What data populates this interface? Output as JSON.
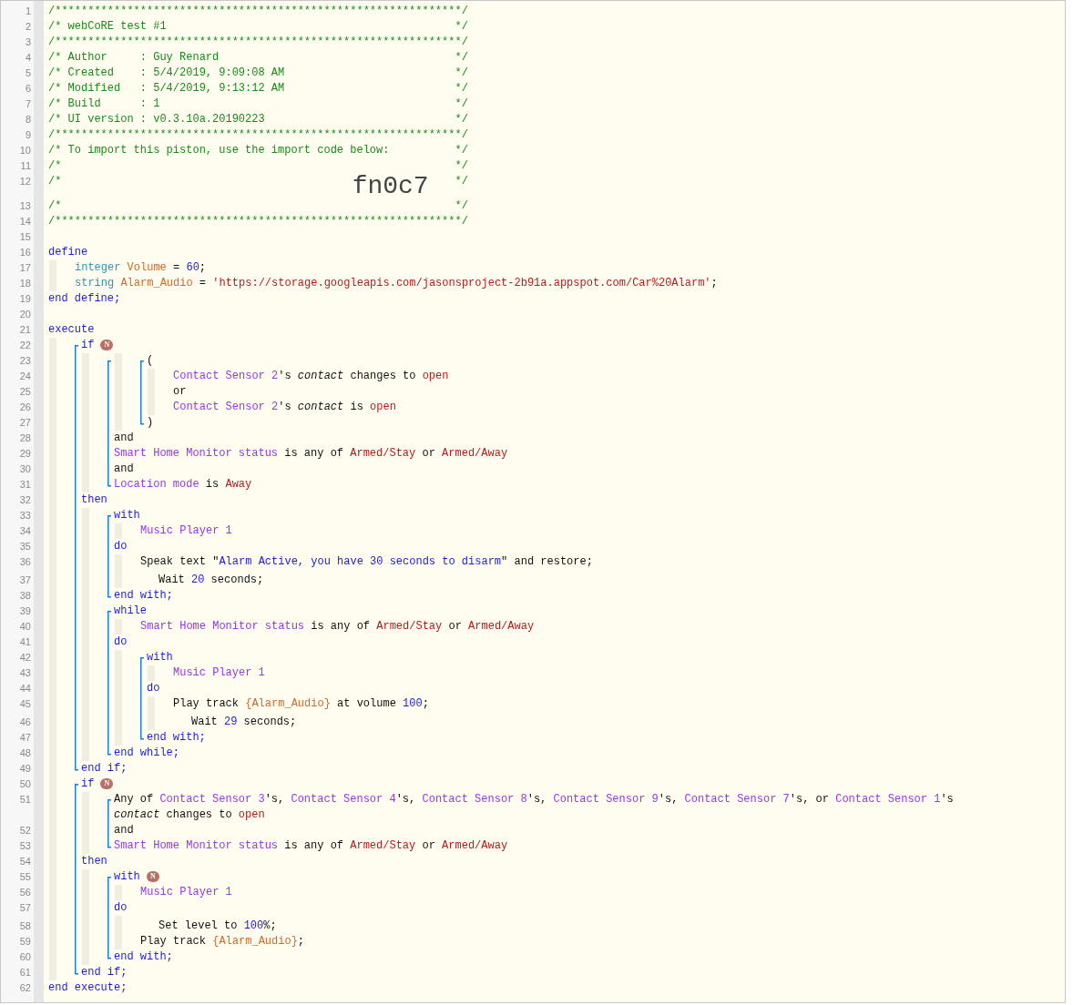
{
  "lines": [
    {
      "kind": "line",
      "no": "1",
      "tokens": [
        {
          "kind": "comment",
          "text": "/**************************************************************/"
        }
      ]
    },
    {
      "kind": "line",
      "no": "2",
      "tokens": [
        {
          "kind": "comment",
          "text": "/* webCoRE test #1"
        },
        {
          "kind": "comment-end",
          "text": "*/"
        }
      ]
    },
    {
      "kind": "line",
      "no": "3",
      "tokens": [
        {
          "kind": "comment",
          "text": "/**************************************************************/"
        }
      ]
    },
    {
      "kind": "line",
      "no": "4",
      "tokens": [
        {
          "kind": "comment",
          "text": "/* Author     : Guy Renard"
        },
        {
          "kind": "comment-end",
          "text": "*/"
        }
      ]
    },
    {
      "kind": "line",
      "no": "5",
      "tokens": [
        {
          "kind": "comment",
          "text": "/* Created    : 5/4/2019, 9:09:08 AM"
        },
        {
          "kind": "comment-end",
          "text": "*/"
        }
      ]
    },
    {
      "kind": "line",
      "no": "6",
      "tokens": [
        {
          "kind": "comment",
          "text": "/* Modified   : 5/4/2019, 9:13:12 AM"
        },
        {
          "kind": "comment-end",
          "text": "*/"
        }
      ]
    },
    {
      "kind": "line",
      "no": "7",
      "tokens": [
        {
          "kind": "comment",
          "text": "/* Build      : 1"
        },
        {
          "kind": "comment-end",
          "text": "*/"
        }
      ]
    },
    {
      "kind": "line",
      "no": "8",
      "tokens": [
        {
          "kind": "comment",
          "text": "/* UI version : v0.3.10a.20190223"
        },
        {
          "kind": "comment-end",
          "text": "*/"
        }
      ]
    },
    {
      "kind": "line",
      "no": "9",
      "tokens": [
        {
          "kind": "comment",
          "text": "/**************************************************************/"
        }
      ]
    },
    {
      "kind": "line",
      "no": "10",
      "tokens": [
        {
          "kind": "comment",
          "text": "/* To import this piston, use the import code below:"
        },
        {
          "kind": "comment-end",
          "text": "*/"
        }
      ]
    },
    {
      "kind": "line",
      "no": "11",
      "tokens": [
        {
          "kind": "comment",
          "text": "/*"
        },
        {
          "kind": "comment-end",
          "text": "*/"
        }
      ]
    },
    {
      "kind": "line",
      "no": "12",
      "tokens": [
        {
          "kind": "comment",
          "text": "/*"
        },
        {
          "kind": "import-code",
          "text": "fn0c7"
        },
        {
          "kind": "comment-end",
          "text": "*/"
        }
      ]
    },
    {
      "kind": "line",
      "no": "13",
      "tokens": [
        {
          "kind": "comment",
          "text": "/*"
        },
        {
          "kind": "comment-end",
          "text": "*/"
        }
      ]
    },
    {
      "kind": "line",
      "no": "14",
      "tokens": [
        {
          "kind": "comment",
          "text": "/**************************************************************/"
        }
      ]
    },
    {
      "kind": "line",
      "no": "15"
    },
    {
      "kind": "line",
      "no": "16",
      "tokens": [
        {
          "kind": "keyword",
          "text": "define"
        }
      ]
    },
    {
      "kind": "indent",
      "children": [
        {
          "kind": "line",
          "no": "17",
          "tokens": [
            {
              "kind": "type",
              "text": "integer "
            },
            {
              "kind": "variable",
              "text": "Volume"
            },
            {
              "kind": "plain",
              "text": " = "
            },
            {
              "kind": "literal",
              "text": "60"
            },
            {
              "kind": "plain",
              "text": ";"
            }
          ]
        },
        {
          "kind": "line",
          "no": "18",
          "tokens": [
            {
              "kind": "type",
              "text": "string "
            },
            {
              "kind": "variable",
              "text": "Alarm_Audio"
            },
            {
              "kind": "plain",
              "text": " = "
            },
            {
              "kind": "value",
              "text": "'https://storage.googleapis.com/jasonsproject-2b91a.appspot.com/Car%20Alarm'"
            },
            {
              "kind": "plain",
              "text": ";"
            }
          ]
        }
      ]
    },
    {
      "kind": "line",
      "no": "19",
      "tokens": [
        {
          "kind": "keyword",
          "text": "end define;"
        }
      ]
    },
    {
      "kind": "line",
      "no": "20"
    },
    {
      "kind": "line",
      "no": "21",
      "tokens": [
        {
          "kind": "keyword",
          "text": "execute"
        }
      ]
    },
    {
      "kind": "indent",
      "children": [
        {
          "kind": "bracket",
          "children": [
            {
              "kind": "line",
              "no": "22",
              "tokens": [
                {
                  "kind": "keyword",
                  "text": "if"
                }
              ],
              "badge": "N"
            },
            {
              "kind": "indent",
              "children": [
                {
                  "kind": "bracket",
                  "children": [
                    {
                      "kind": "indent",
                      "children": [
                        {
                          "kind": "bracket",
                          "children": [
                            {
                              "kind": "line",
                              "no": "23",
                              "tokens": [
                                {
                                  "kind": "plain",
                                  "text": "("
                                }
                              ]
                            },
                            {
                              "kind": "indent",
                              "children": [
                                {
                                  "kind": "line",
                                  "no": "24",
                                  "tokens": [
                                    {
                                      "kind": "device",
                                      "text": "Contact Sensor 2"
                                    },
                                    {
                                      "kind": "plain",
                                      "text": "'s "
                                    },
                                    {
                                      "kind": "attribute",
                                      "text": "contact"
                                    },
                                    {
                                      "kind": "plain",
                                      "text": " changes to "
                                    },
                                    {
                                      "kind": "value",
                                      "text": "open"
                                    }
                                  ]
                                },
                                {
                                  "kind": "line",
                                  "no": "25",
                                  "tokens": [
                                    {
                                      "kind": "plain",
                                      "text": "or"
                                    }
                                  ]
                                },
                                {
                                  "kind": "line",
                                  "no": "26",
                                  "tokens": [
                                    {
                                      "kind": "device",
                                      "text": "Contact Sensor 2"
                                    },
                                    {
                                      "kind": "plain",
                                      "text": "'s "
                                    },
                                    {
                                      "kind": "attribute",
                                      "text": "contact"
                                    },
                                    {
                                      "kind": "plain",
                                      "text": " is "
                                    },
                                    {
                                      "kind": "value",
                                      "text": "open"
                                    }
                                  ]
                                }
                              ]
                            },
                            {
                              "kind": "line",
                              "no": "27",
                              "tokens": [
                                {
                                  "kind": "plain",
                                  "text": ")"
                                }
                              ]
                            }
                          ]
                        }
                      ]
                    },
                    {
                      "kind": "line",
                      "no": "28",
                      "tokens": [
                        {
                          "kind": "plain",
                          "text": "and"
                        }
                      ]
                    },
                    {
                      "kind": "line",
                      "no": "29",
                      "tokens": [
                        {
                          "kind": "device",
                          "text": "Smart Home Monitor status"
                        },
                        {
                          "kind": "plain",
                          "text": " is any of "
                        },
                        {
                          "kind": "value",
                          "text": "Armed/Stay"
                        },
                        {
                          "kind": "plain",
                          "text": " or "
                        },
                        {
                          "kind": "value",
                          "text": "Armed/Away"
                        }
                      ]
                    },
                    {
                      "kind": "line",
                      "no": "30",
                      "tokens": [
                        {
                          "kind": "plain",
                          "text": "and"
                        }
                      ]
                    },
                    {
                      "kind": "line",
                      "no": "31",
                      "tokens": [
                        {
                          "kind": "device",
                          "text": "Location mode"
                        },
                        {
                          "kind": "plain",
                          "text": " is "
                        },
                        {
                          "kind": "value",
                          "text": "Away"
                        }
                      ]
                    }
                  ]
                }
              ]
            },
            {
              "kind": "line",
              "no": "32",
              "tokens": [
                {
                  "kind": "keyword",
                  "text": "then"
                }
              ]
            },
            {
              "kind": "indent",
              "children": [
                {
                  "kind": "bracket",
                  "children": [
                    {
                      "kind": "line",
                      "no": "33",
                      "tokens": [
                        {
                          "kind": "keyword",
                          "text": "with"
                        }
                      ]
                    },
                    {
                      "kind": "indent",
                      "children": [
                        {
                          "kind": "line",
                          "no": "34",
                          "tokens": [
                            {
                              "kind": "device",
                              "text": "Music Player 1"
                            }
                          ]
                        }
                      ]
                    },
                    {
                      "kind": "line",
                      "no": "35",
                      "tokens": [
                        {
                          "kind": "keyword",
                          "text": "do"
                        }
                      ]
                    },
                    {
                      "kind": "indent",
                      "children": [
                        {
                          "kind": "line",
                          "no": "36",
                          "tokens": [
                            {
                              "kind": "plain",
                              "text": "Speak text \""
                            },
                            {
                              "kind": "literal",
                              "text": "Alarm Active, you have 30 seconds to disarm"
                            },
                            {
                              "kind": "plain",
                              "text": "\" and restore;"
                            }
                          ]
                        },
                        {
                          "kind": "shift",
                          "children": [
                            {
                              "kind": "line",
                              "no": "37",
                              "tokens": [
                                {
                                  "kind": "plain",
                                  "text": "Wait "
                                },
                                {
                                  "kind": "literal",
                                  "text": "20"
                                },
                                {
                                  "kind": "plain",
                                  "text": " seconds;"
                                }
                              ]
                            }
                          ]
                        }
                      ]
                    },
                    {
                      "kind": "line",
                      "no": "38",
                      "tokens": [
                        {
                          "kind": "keyword",
                          "text": "end with;"
                        }
                      ]
                    }
                  ]
                },
                {
                  "kind": "bracket",
                  "children": [
                    {
                      "kind": "line",
                      "no": "39",
                      "tokens": [
                        {
                          "kind": "keyword",
                          "text": "while"
                        }
                      ]
                    },
                    {
                      "kind": "indent",
                      "children": [
                        {
                          "kind": "line",
                          "no": "40",
                          "tokens": [
                            {
                              "kind": "device",
                              "text": "Smart Home Monitor status"
                            },
                            {
                              "kind": "plain",
                              "text": " is any of "
                            },
                            {
                              "kind": "value",
                              "text": "Armed/Stay"
                            },
                            {
                              "kind": "plain",
                              "text": " or "
                            },
                            {
                              "kind": "value",
                              "text": "Armed/Away"
                            }
                          ]
                        }
                      ]
                    },
                    {
                      "kind": "line",
                      "no": "41",
                      "tokens": [
                        {
                          "kind": "keyword",
                          "text": "do"
                        }
                      ]
                    },
                    {
                      "kind": "indent",
                      "children": [
                        {
                          "kind": "bracket",
                          "children": [
                            {
                              "kind": "line",
                              "no": "42",
                              "tokens": [
                                {
                                  "kind": "keyword",
                                  "text": "with"
                                }
                              ]
                            },
                            {
                              "kind": "indent",
                              "children": [
                                {
                                  "kind": "line",
                                  "no": "43",
                                  "tokens": [
                                    {
                                      "kind": "device",
                                      "text": "Music Player 1"
                                    }
                                  ]
                                }
                              ]
                            },
                            {
                              "kind": "line",
                              "no": "44",
                              "tokens": [
                                {
                                  "kind": "keyword",
                                  "text": "do"
                                }
                              ]
                            },
                            {
                              "kind": "indent",
                              "children": [
                                {
                                  "kind": "line",
                                  "no": "45",
                                  "tokens": [
                                    {
                                      "kind": "plain",
                                      "text": "Play track "
                                    },
                                    {
                                      "kind": "variable",
                                      "text": "{Alarm_Audio}"
                                    },
                                    {
                                      "kind": "plain",
                                      "text": " at volume "
                                    },
                                    {
                                      "kind": "literal",
                                      "text": "100"
                                    },
                                    {
                                      "kind": "plain",
                                      "text": ";"
                                    }
                                  ]
                                },
                                {
                                  "kind": "shift",
                                  "children": [
                                    {
                                      "kind": "line",
                                      "no": "46",
                                      "tokens": [
                                        {
                                          "kind": "plain",
                                          "text": "Wait "
                                        },
                                        {
                                          "kind": "literal",
                                          "text": "29"
                                        },
                                        {
                                          "kind": "plain",
                                          "text": " seconds;"
                                        }
                                      ]
                                    }
                                  ]
                                }
                              ]
                            },
                            {
                              "kind": "line",
                              "no": "47",
                              "tokens": [
                                {
                                  "kind": "keyword",
                                  "text": "end with;"
                                }
                              ]
                            }
                          ]
                        }
                      ]
                    },
                    {
                      "kind": "line",
                      "no": "48",
                      "tokens": [
                        {
                          "kind": "keyword",
                          "text": "end while;"
                        }
                      ]
                    }
                  ]
                }
              ]
            },
            {
              "kind": "line",
              "no": "49",
              "tokens": [
                {
                  "kind": "keyword",
                  "text": "end if;"
                }
              ]
            }
          ]
        },
        {
          "kind": "bracket",
          "children": [
            {
              "kind": "line",
              "no": "50",
              "tokens": [
                {
                  "kind": "keyword",
                  "text": "if"
                }
              ],
              "badge": "N"
            },
            {
              "kind": "indent",
              "children": [
                {
                  "kind": "bracket",
                  "children": [
                    {
                      "kind": "line",
                      "no": "51",
                      "tokens": [
                        {
                          "kind": "plain",
                          "text": "Any of "
                        },
                        {
                          "kind": "device",
                          "text": "Contact Sensor 3"
                        },
                        {
                          "kind": "plain",
                          "text": "'s, "
                        },
                        {
                          "kind": "device",
                          "text": "Contact Sensor 4"
                        },
                        {
                          "kind": "plain",
                          "text": "'s, "
                        },
                        {
                          "kind": "device",
                          "text": "Contact Sensor 8"
                        },
                        {
                          "kind": "plain",
                          "text": "'s, "
                        },
                        {
                          "kind": "device",
                          "text": "Contact Sensor 9"
                        },
                        {
                          "kind": "plain",
                          "text": "'s, "
                        },
                        {
                          "kind": "device",
                          "text": "Contact Sensor 7"
                        },
                        {
                          "kind": "plain",
                          "text": "'s, or "
                        },
                        {
                          "kind": "device",
                          "text": "Contact Sensor 1"
                        },
                        {
                          "kind": "plain",
                          "text": "'s"
                        },
                        {
                          "kind": "break"
                        },
                        {
                          "kind": "attribute",
                          "text": "contact"
                        },
                        {
                          "kind": "plain",
                          "text": " changes to "
                        },
                        {
                          "kind": "value",
                          "text": "open"
                        }
                      ]
                    },
                    {
                      "kind": "line",
                      "no": "52",
                      "tokens": [
                        {
                          "kind": "plain",
                          "text": "and"
                        }
                      ]
                    },
                    {
                      "kind": "line",
                      "no": "53",
                      "tokens": [
                        {
                          "kind": "device",
                          "text": "Smart Home Monitor status"
                        },
                        {
                          "kind": "plain",
                          "text": " is any of "
                        },
                        {
                          "kind": "value",
                          "text": "Armed/Stay"
                        },
                        {
                          "kind": "plain",
                          "text": " or "
                        },
                        {
                          "kind": "value",
                          "text": "Armed/Away"
                        }
                      ]
                    }
                  ]
                }
              ]
            },
            {
              "kind": "line",
              "no": "54",
              "tokens": [
                {
                  "kind": "keyword",
                  "text": "then"
                }
              ]
            },
            {
              "kind": "indent",
              "children": [
                {
                  "kind": "bracket",
                  "children": [
                    {
                      "kind": "line",
                      "no": "55",
                      "tokens": [
                        {
                          "kind": "keyword",
                          "text": "with"
                        }
                      ],
                      "badge": "N"
                    },
                    {
                      "kind": "indent",
                      "children": [
                        {
                          "kind": "line",
                          "no": "56",
                          "tokens": [
                            {
                              "kind": "device",
                              "text": "Music Player 1"
                            }
                          ]
                        }
                      ]
                    },
                    {
                      "kind": "line",
                      "no": "57",
                      "tokens": [
                        {
                          "kind": "keyword",
                          "text": "do"
                        }
                      ]
                    },
                    {
                      "kind": "indent",
                      "children": [
                        {
                          "kind": "shift",
                          "children": [
                            {
                              "kind": "line",
                              "no": "58",
                              "tokens": [
                                {
                                  "kind": "plain",
                                  "text": "Set level to "
                                },
                                {
                                  "kind": "literal",
                                  "text": "100"
                                },
                                {
                                  "kind": "plain",
                                  "text": "%;"
                                }
                              ]
                            }
                          ]
                        },
                        {
                          "kind": "line",
                          "no": "59",
                          "tokens": [
                            {
                              "kind": "plain",
                              "text": "Play track "
                            },
                            {
                              "kind": "variable",
                              "text": "{Alarm_Audio}"
                            },
                            {
                              "kind": "plain",
                              "text": ";"
                            }
                          ]
                        }
                      ]
                    },
                    {
                      "kind": "line",
                      "no": "60",
                      "tokens": [
                        {
                          "kind": "keyword",
                          "text": "end with;"
                        }
                      ]
                    }
                  ]
                }
              ]
            },
            {
              "kind": "line",
              "no": "61",
              "tokens": [
                {
                  "kind": "keyword",
                  "text": "end if;"
                }
              ]
            }
          ]
        }
      ]
    },
    {
      "kind": "line",
      "no": "62",
      "tokens": [
        {
          "kind": "keyword",
          "text": "end execute;"
        }
      ]
    }
  ]
}
